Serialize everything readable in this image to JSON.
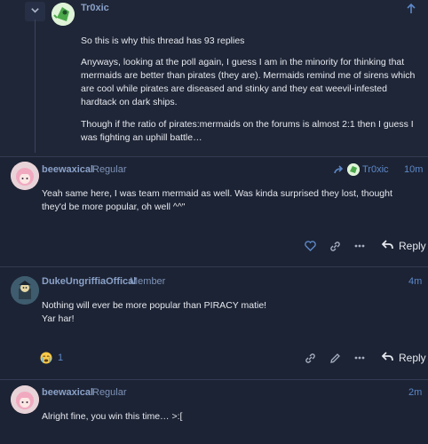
{
  "top_post": {
    "username": "Tr0xic",
    "paragraphs": [
      "So this is why this thread has 93 replies",
      "Anyways, looking at the poll again, I guess I am in the minority for thinking that mermaids are better than pirates (they are). Mermaids remind me of sirens which are cool while pirates are diseased and stinky and they eat weevil-infested hardtack on dark ships.",
      "Though if the ratio of pirates:mermaids on the forums is almost 2:1 then I guess I was fighting an uphill battle…"
    ]
  },
  "posts": [
    {
      "username": "beewaxical",
      "role": "Regular",
      "reply_to": "Tr0xic",
      "time": "10m",
      "text": "Yeah same here, I was team mermaid as well. Was kinda surprised they lost, thought they'd be more popular, oh well ^^\"",
      "reply_label": "Reply"
    },
    {
      "username": "DukeUngriffiaOffical",
      "role": "Member",
      "time": "4m",
      "text_lines": [
        "Nothing will ever be more popular than PIRACY matie!",
        "Yar har!"
      ],
      "reaction_count": "1",
      "reply_label": "Reply"
    },
    {
      "username": "beewaxical",
      "role": "Regular",
      "time": "2m",
      "text": "Alright fine, you win this time… >:["
    }
  ],
  "colors": {
    "background": "#1c2334",
    "accent": "#5c88c8",
    "username": "#8aa1c8"
  }
}
